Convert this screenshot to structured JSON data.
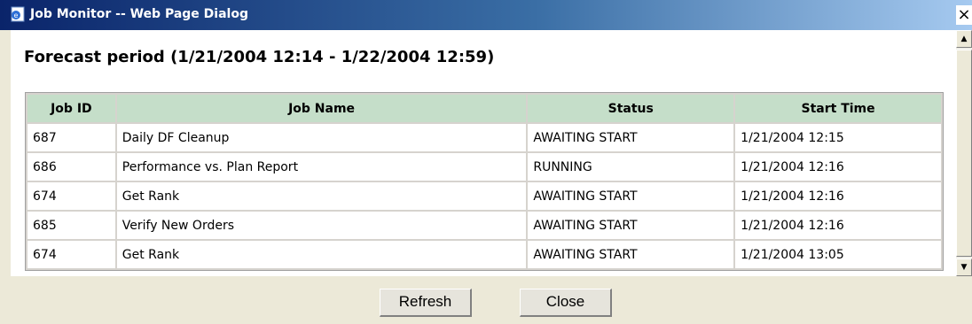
{
  "window": {
    "title": "Job Monitor -- Web Page Dialog",
    "close_label": "×"
  },
  "heading": "Forecast period (1/21/2004 12:14 - 1/22/2004 12:59)",
  "table": {
    "headers": [
      "Job ID",
      "Job Name",
      "Status",
      "Start Time"
    ],
    "rows": [
      [
        "687",
        "Daily DF Cleanup",
        "AWAITING START",
        "1/21/2004 12:15"
      ],
      [
        "686",
        "Performance vs. Plan Report",
        "RUNNING",
        "1/21/2004 12:16"
      ],
      [
        "674",
        "Get Rank",
        "AWAITING START",
        "1/21/2004 12:16"
      ],
      [
        "685",
        "Verify New Orders",
        "AWAITING START",
        "1/21/2004 12:16"
      ],
      [
        "674",
        "Get Rank",
        "AWAITING START",
        "1/21/2004 13:05"
      ]
    ]
  },
  "buttons": {
    "refresh": "Refresh",
    "close": "Close"
  },
  "colors": {
    "header_bg": "#c5dec9",
    "titlebar": "#0a246a"
  }
}
